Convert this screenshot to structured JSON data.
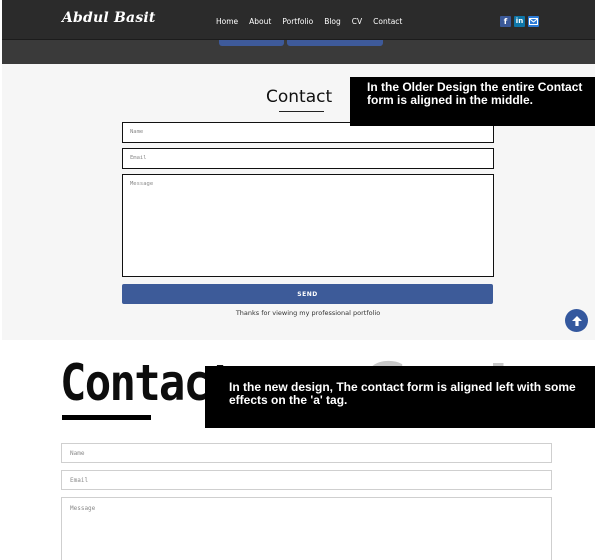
{
  "old_design": {
    "logo": "Abdul Basit",
    "nav": [
      "Home",
      "About",
      "Portfolio",
      "Blog",
      "CV",
      "Contact"
    ],
    "social_icons": [
      "facebook-icon",
      "linkedin-icon",
      "mail-icon"
    ],
    "title": "Contact",
    "fields": {
      "name_placeholder": "Name",
      "email_placeholder": "Email",
      "message_placeholder": "Message"
    },
    "send_label": "SEND",
    "thanks": "Thanks for viewing my professional portfolio",
    "scroll_top_icon": "arrow-up-icon",
    "accent_color": "#3d5b99"
  },
  "annotations": {
    "old": "In the Older Design the entire Contact form is aligned in the middle.",
    "new": "In the new design, The contact form is aligned left with some effects on the 'a' tag."
  },
  "new_design": {
    "title": "Contact",
    "ghost_title": "Contac",
    "fields": {
      "name_placeholder": "Name",
      "email_placeholder": "Email",
      "message_placeholder": "Message"
    }
  }
}
